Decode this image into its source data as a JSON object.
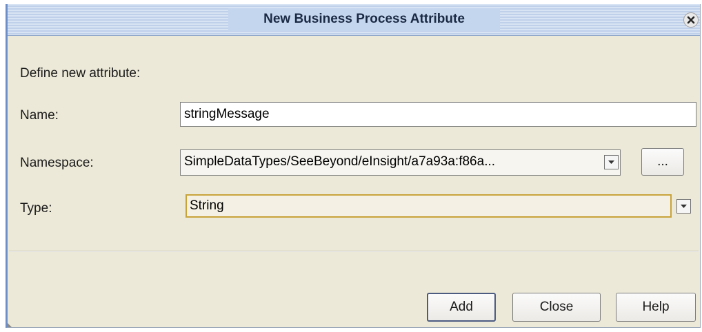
{
  "window": {
    "title": "New Business Process Attribute"
  },
  "form": {
    "heading": "Define new attribute:",
    "name_label": "Name:",
    "name_value": "stringMessage",
    "namespace_label": "Namespace:",
    "namespace_value": "SimpleDataTypes/SeeBeyond/eInsight/a7a93a:f86a...",
    "browse_label": "...",
    "type_label": "Type:",
    "type_value": "String"
  },
  "buttons": {
    "add": "Add",
    "close": "Close",
    "help": "Help"
  },
  "icons": {
    "close": "close-icon",
    "dropdown": "chevron-down-icon"
  },
  "colors": {
    "dialog_bg": "#ece9d8",
    "title_text": "#1b2a44",
    "focus_border": "#c8a33a"
  }
}
